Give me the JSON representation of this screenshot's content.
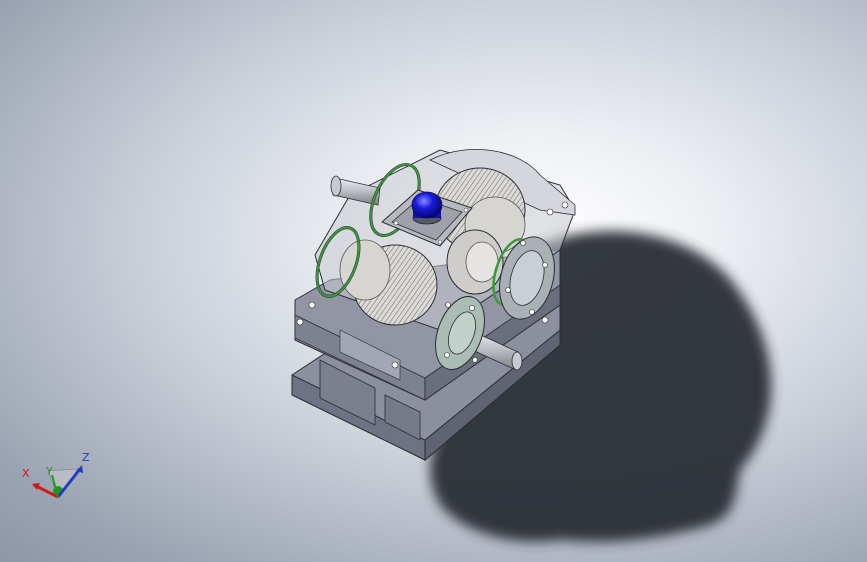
{
  "viewport": {
    "background_center": "#ffffff",
    "background_edge": "#8d97a6"
  },
  "model": {
    "housing_color": "#8b8f9e",
    "housing_dark": "#5f6372",
    "gear_color": "#d7d5d2",
    "flange_color": "#a9bdb5",
    "seal_color": "#3a9a3a",
    "breather_cap_color": "#1a1adb",
    "shadow_color": "#2c2f34"
  },
  "triad": {
    "x_label": "X",
    "y_label": "Y",
    "z_label": "Z",
    "x_color": "#cc1b1b",
    "y_color": "#1d9a1d",
    "z_color": "#1f3fbf"
  }
}
